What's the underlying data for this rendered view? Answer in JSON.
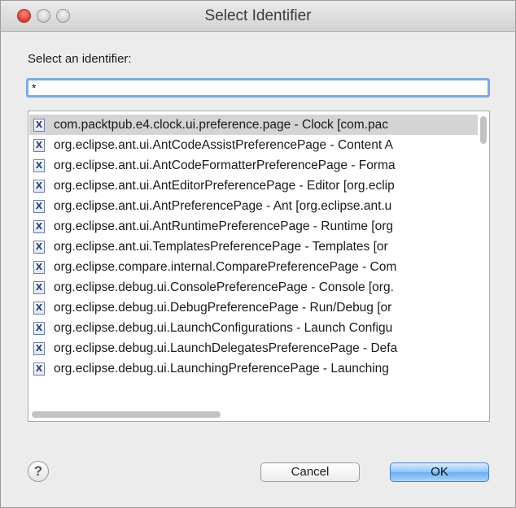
{
  "window": {
    "title": "Select Identifier"
  },
  "dialog": {
    "prompt": "Select an identifier:",
    "filter_value": "*"
  },
  "list": {
    "items": [
      {
        "icon": "x-class-icon",
        "text": "com.packtpub.e4.clock.ui.preference.page - Clock [com.pac"
      },
      {
        "icon": "x-class-icon",
        "text": "org.eclipse.ant.ui.AntCodeAssistPreferencePage - Content A"
      },
      {
        "icon": "x-class-icon",
        "text": "org.eclipse.ant.ui.AntCodeFormatterPreferencePage - Forma"
      },
      {
        "icon": "x-class-icon",
        "text": "org.eclipse.ant.ui.AntEditorPreferencePage - Editor [org.eclip"
      },
      {
        "icon": "x-class-icon",
        "text": "org.eclipse.ant.ui.AntPreferencePage - Ant [org.eclipse.ant.u"
      },
      {
        "icon": "x-class-icon",
        "text": "org.eclipse.ant.ui.AntRuntimePreferencePage - Runtime [org"
      },
      {
        "icon": "x-class-icon",
        "text": "org.eclipse.ant.ui.TemplatesPreferencePage - Templates [or"
      },
      {
        "icon": "x-class-icon",
        "text": "org.eclipse.compare.internal.ComparePreferencePage - Com"
      },
      {
        "icon": "x-class-icon",
        "text": "org.eclipse.debug.ui.ConsolePreferencePage - Console [org."
      },
      {
        "icon": "x-class-icon",
        "text": "org.eclipse.debug.ui.DebugPreferencePage - Run/Debug [or"
      },
      {
        "icon": "x-class-icon",
        "text": "org.eclipse.debug.ui.LaunchConfigurations - Launch Configu"
      },
      {
        "icon": "x-class-icon",
        "text": "org.eclipse.debug.ui.LaunchDelegatesPreferencePage - Defa"
      },
      {
        "icon": "x-class-icon",
        "text": "org.eclipse.debug.ui.LaunchingPreferencePage - Launching"
      }
    ],
    "selected_index": 0,
    "icon_glyph": "X"
  },
  "footer": {
    "help_glyph": "?",
    "cancel_label": "Cancel",
    "ok_label": "OK"
  },
  "colors": {
    "ok_button": "#6cafef",
    "selection": "#d4d4d4",
    "focus_ring": "#7fa9e3"
  }
}
